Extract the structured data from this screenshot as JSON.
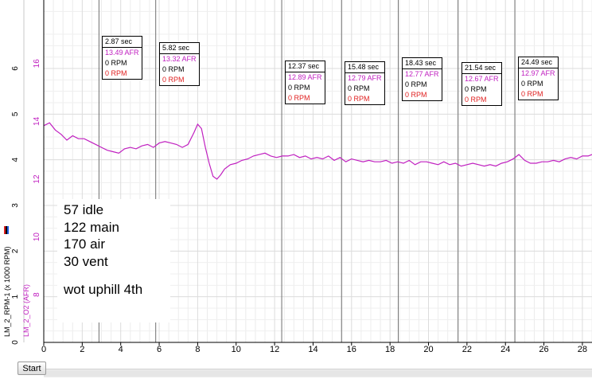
{
  "chart_data": {
    "type": "line",
    "title": "",
    "xlabel": "",
    "xlim": [
      0,
      28.5
    ],
    "x_ticks": [
      "0",
      "2",
      "4",
      "6",
      "8",
      "10",
      "12",
      "14",
      "16",
      "18",
      "20",
      "22",
      "24",
      "26",
      "28"
    ],
    "y_axes": [
      {
        "label": "LM_2_RPM-1 (x 1000 RPM)",
        "color": "#000000",
        "ylim": [
          0,
          7.5
        ],
        "ticks": [
          "0",
          "1",
          "2",
          "3",
          "4",
          "5",
          "6"
        ]
      },
      {
        "label": "LM_2_O2 (AFR)",
        "color": "#c020c0",
        "ylim": [
          6.35,
          18.2
        ],
        "ticks": [
          "8",
          "10",
          "12",
          "14",
          "16"
        ]
      }
    ],
    "grid": true,
    "series": [
      {
        "name": "LM_2_O2 (AFR)",
        "color": "#c020c0",
        "x": [
          0,
          0.3,
          0.6,
          0.9,
          1.2,
          1.5,
          1.8,
          2.1,
          2.4,
          2.7,
          3.0,
          3.3,
          3.6,
          3.9,
          4.2,
          4.5,
          4.8,
          5.1,
          5.4,
          5.7,
          6.0,
          6.3,
          6.6,
          6.9,
          7.2,
          7.5,
          7.8,
          8.0,
          8.2,
          8.4,
          8.6,
          8.8,
          9.0,
          9.2,
          9.4,
          9.7,
          10.0,
          10.3,
          10.6,
          10.9,
          11.2,
          11.5,
          11.8,
          12.1,
          12.4,
          12.7,
          13.0,
          13.3,
          13.6,
          13.9,
          14.2,
          14.5,
          14.8,
          15.1,
          15.4,
          15.7,
          16.0,
          16.3,
          16.6,
          16.9,
          17.2,
          17.5,
          17.8,
          18.1,
          18.4,
          18.7,
          19.0,
          19.3,
          19.6,
          19.9,
          20.2,
          20.5,
          20.8,
          21.1,
          21.4,
          21.7,
          22.0,
          22.3,
          22.6,
          22.9,
          23.2,
          23.5,
          23.8,
          24.1,
          24.4,
          24.7,
          25.0,
          25.3,
          25.6,
          25.9,
          26.2,
          26.5,
          26.8,
          27.1,
          27.4,
          27.7,
          28.0,
          28.3,
          28.5
        ],
        "y": [
          13.85,
          13.95,
          13.7,
          13.55,
          13.35,
          13.5,
          13.4,
          13.4,
          13.3,
          13.2,
          13.1,
          13.0,
          12.95,
          12.9,
          13.05,
          13.1,
          13.05,
          13.15,
          13.2,
          13.1,
          13.25,
          13.3,
          13.25,
          13.2,
          13.1,
          13.2,
          13.6,
          13.9,
          13.75,
          13.1,
          12.55,
          12.1,
          12.0,
          12.15,
          12.35,
          12.5,
          12.55,
          12.65,
          12.7,
          12.8,
          12.85,
          12.9,
          12.8,
          12.75,
          12.8,
          12.8,
          12.85,
          12.75,
          12.8,
          12.7,
          12.75,
          12.7,
          12.8,
          12.65,
          12.75,
          12.6,
          12.7,
          12.65,
          12.6,
          12.65,
          12.6,
          12.6,
          12.65,
          12.55,
          12.6,
          12.55,
          12.65,
          12.5,
          12.6,
          12.6,
          12.55,
          12.5,
          12.6,
          12.5,
          12.55,
          12.45,
          12.5,
          12.55,
          12.5,
          12.45,
          12.5,
          12.45,
          12.55,
          12.6,
          12.7,
          12.85,
          12.65,
          12.55,
          12.55,
          12.6,
          12.6,
          12.65,
          12.6,
          12.7,
          12.75,
          12.7,
          12.8,
          12.8,
          12.85
        ]
      }
    ],
    "cursors": [
      {
        "x": 2.87,
        "time": "2.87 sec",
        "afr": "13.49 AFR",
        "rpm1": "0 RPM",
        "rpm2": "0 RPM"
      },
      {
        "x": 5.82,
        "time": "5.82 sec",
        "afr": "13.32 AFR",
        "rpm1": "0 RPM",
        "rpm2": "0 RPM"
      },
      {
        "x": 12.37,
        "time": "12.37 sec",
        "afr": "12.89 AFR",
        "rpm1": "0 RPM",
        "rpm2": "0 RPM"
      },
      {
        "x": 15.48,
        "time": "15.48 sec",
        "afr": "12.79 AFR",
        "rpm1": "0 RPM",
        "rpm2": "0 RPM"
      },
      {
        "x": 18.43,
        "time": "18.43 sec",
        "afr": "12.77 AFR",
        "rpm1": "0 RPM",
        "rpm2": "0 RPM"
      },
      {
        "x": 21.54,
        "time": "21.54 sec",
        "afr": "12.67 AFR",
        "rpm1": "0 RPM",
        "rpm2": "0 RPM"
      },
      {
        "x": 24.49,
        "time": "24.49 sec",
        "afr": "12.97 AFR",
        "rpm1": "0 RPM",
        "rpm2": "0 RPM"
      }
    ],
    "annotation": {
      "lines": [
        "57 idle",
        "122 main",
        "170 air",
        "30 vent",
        "",
        "wot uphill 4th"
      ]
    }
  },
  "ui": {
    "start_button": "Start"
  }
}
